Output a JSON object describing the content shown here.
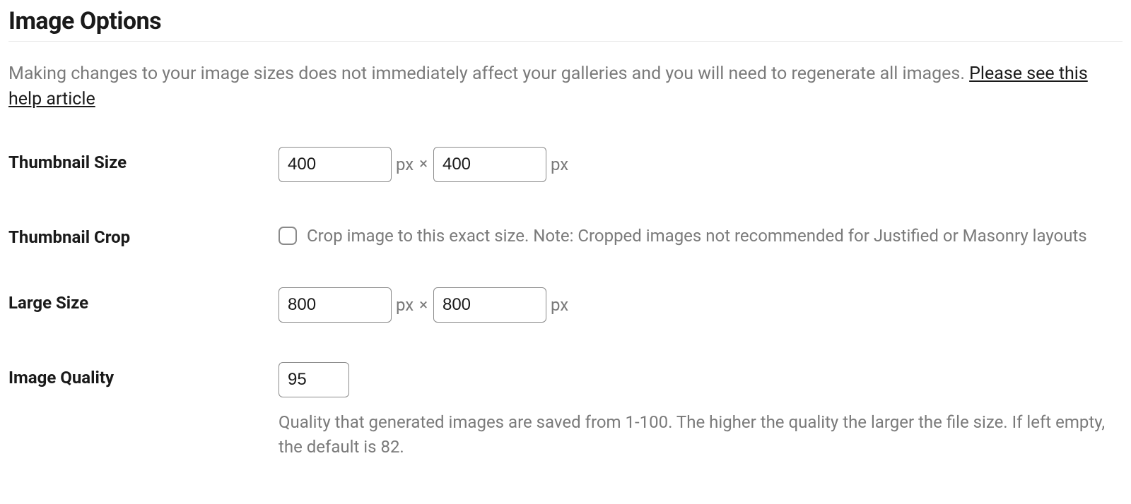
{
  "title": "Image Options",
  "intro": {
    "text": "Making changes to your image sizes does not immediately affect your galleries and you will need to regenerate all images. ",
    "link_text": "Please see this help article"
  },
  "units": {
    "px": "px",
    "times": "×"
  },
  "thumbnail_size": {
    "label": "Thumbnail Size",
    "width": "400",
    "height": "400"
  },
  "thumbnail_crop": {
    "label": "Thumbnail Crop",
    "text": "Crop image to this exact size. Note: Cropped images not recommended for Justified or Masonry layouts"
  },
  "large_size": {
    "label": "Large Size",
    "width": "800",
    "height": "800"
  },
  "image_quality": {
    "label": "Image Quality",
    "value": "95",
    "help": "Quality that generated images are saved from 1-100. The higher the quality the larger the file size. If left empty, the default is 82."
  }
}
